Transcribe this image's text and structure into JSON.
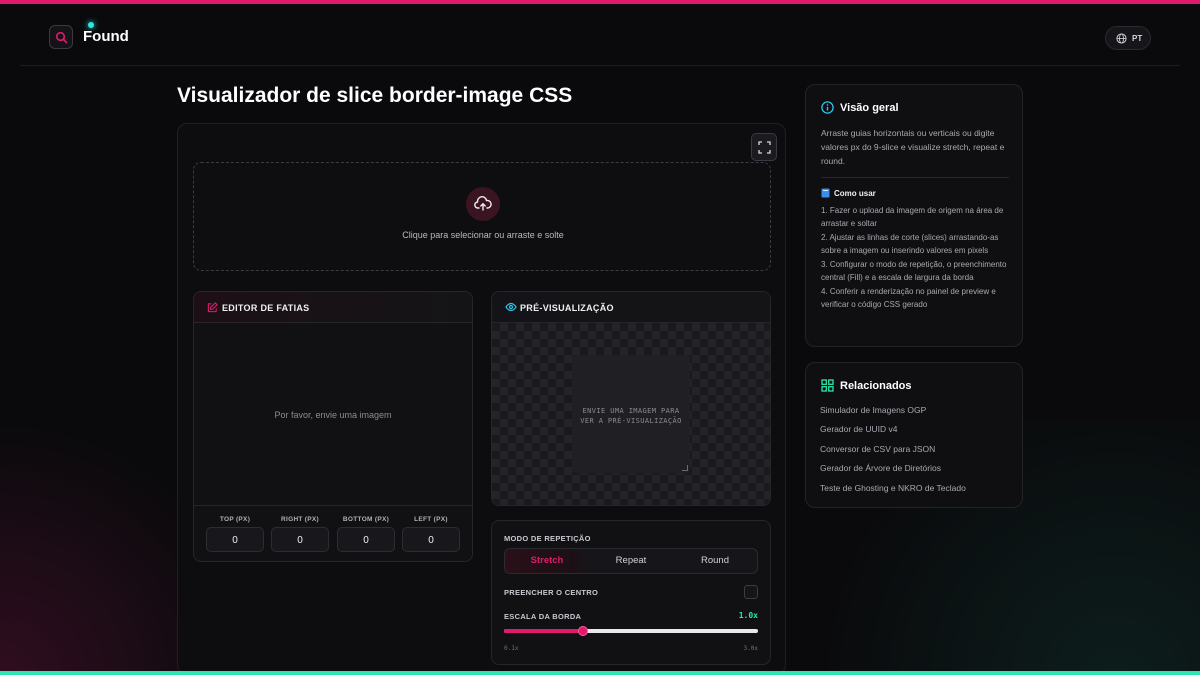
{
  "brand": {
    "name": "Found",
    "accent": "#e0196b",
    "secondary": "#2ee6b0"
  },
  "header": {
    "lang_label": "PT",
    "lang_icon": "globe-icon"
  },
  "page": {
    "title": "Visualizador de slice border-image CSS"
  },
  "dropzone": {
    "text": "Clique para selecionar ou arraste e solte",
    "icon": "cloud-upload-icon"
  },
  "editor": {
    "title": "EDITOR DE FATIAS",
    "empty_text": "Por favor, envie uma imagem",
    "fields": [
      {
        "label": "TOP (PX)",
        "value": "0"
      },
      {
        "label": "RIGHT (PX)",
        "value": "0"
      },
      {
        "label": "BOTTOM (PX)",
        "value": "0"
      },
      {
        "label": "LEFT (PX)",
        "value": "0"
      }
    ]
  },
  "preview": {
    "title": "PRÉ-VISUALIZAÇÃO",
    "line1": "ENVIE UMA IMAGEM PARA",
    "line2": "VER A PRÉ-VISUALIZAÇÃO"
  },
  "controls": {
    "repeat_label": "MODO DE REPETIÇÃO",
    "modes": [
      "Stretch",
      "Repeat",
      "Round"
    ],
    "active_mode": "Stretch",
    "fill_label": "PREENCHER O CENTRO",
    "fill_checked": false,
    "scale_label": "ESCALA DA BORDA",
    "scale_value": "1.0x",
    "scale_min": "0.1x",
    "scale_max": "3.0x",
    "scale_fraction": 0.31
  },
  "overview": {
    "title": "Visão geral",
    "description": "Arraste guias horizontais ou verticais ou digite valores px do 9-slice e visualize stretch, repeat e round.",
    "howto_title": "Como usar",
    "steps": [
      "1. Fazer o upload da imagem de origem na área de arrastar e soltar",
      "2. Ajustar as linhas de corte (slices) arrastando-as sobre a imagem ou inserindo valores em pixels",
      "3. Configurar o modo de repetição, o preenchimento central (Fill) e a escala de largura da borda",
      "4. Conferir a renderização no painel de preview e verificar o código CSS gerado"
    ]
  },
  "related": {
    "title": "Relacionados",
    "links": [
      "Simulador de Imagens OGP",
      "Gerador de UUID v4",
      "Conversor de CSV para JSON",
      "Gerador de Árvore de Diretórios",
      "Teste de Ghosting e NKRO de Teclado"
    ]
  }
}
